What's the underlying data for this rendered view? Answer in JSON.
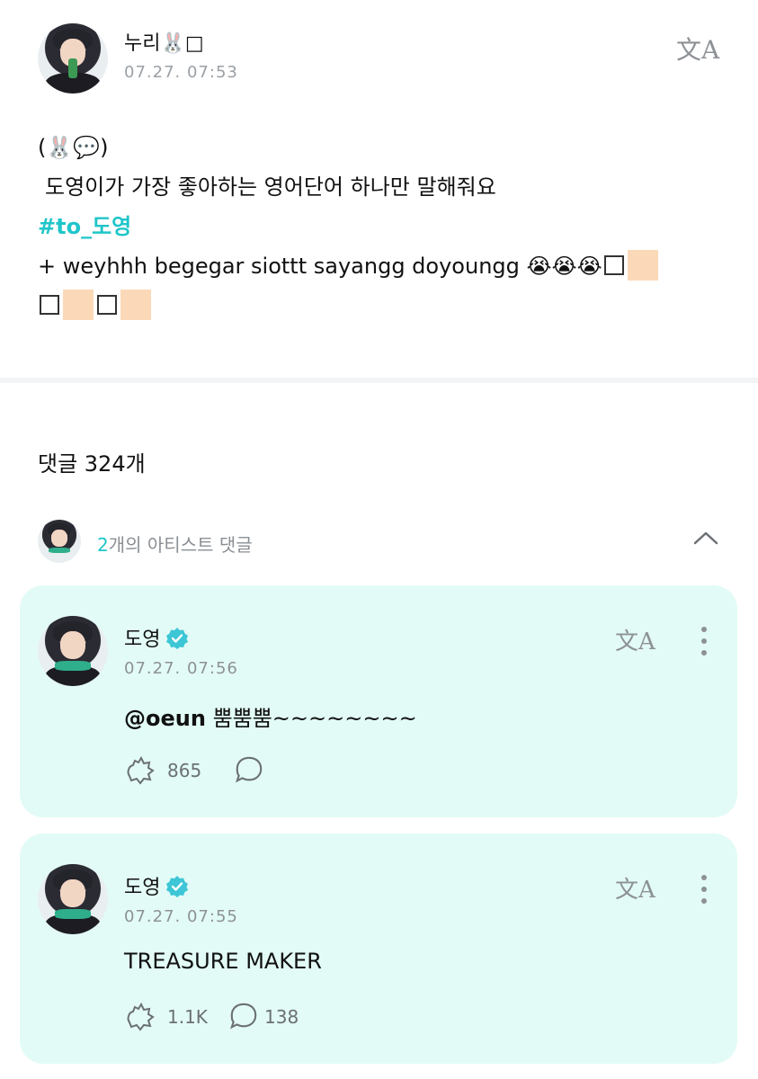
{
  "post": {
    "author_name": "누리🐰□",
    "timestamp": "07.27. 07:53",
    "translate_icon": "translate-icon",
    "line1": "(🐰💬)",
    "line2": "도영이가 가장 좋아하는 영어단어 하나만 말해줘요",
    "hashtag": "#to_도영",
    "line4": "+ weyhhh begegar siottt sayangg doyoungg 😭😭😭"
  },
  "comments": {
    "count_label": "댓글 324개",
    "artist_count": "2",
    "artist_label": "개의 아티스트 댓글",
    "items": [
      {
        "author": "도영",
        "timestamp": "07.27. 07:56",
        "mention": "@oeun",
        "text": " 뿜뿜뿜~~~~~~~~",
        "likes": "865",
        "replies": ""
      },
      {
        "author": "도영",
        "timestamp": "07.27. 07:55",
        "mention": "",
        "text": "TREASURE MAKER",
        "likes": "1.1K",
        "replies": "138"
      }
    ]
  },
  "colors": {
    "accent": "#1fc5c9",
    "card_bg": "#e2fbf6",
    "verified": "#3cc6d6"
  }
}
